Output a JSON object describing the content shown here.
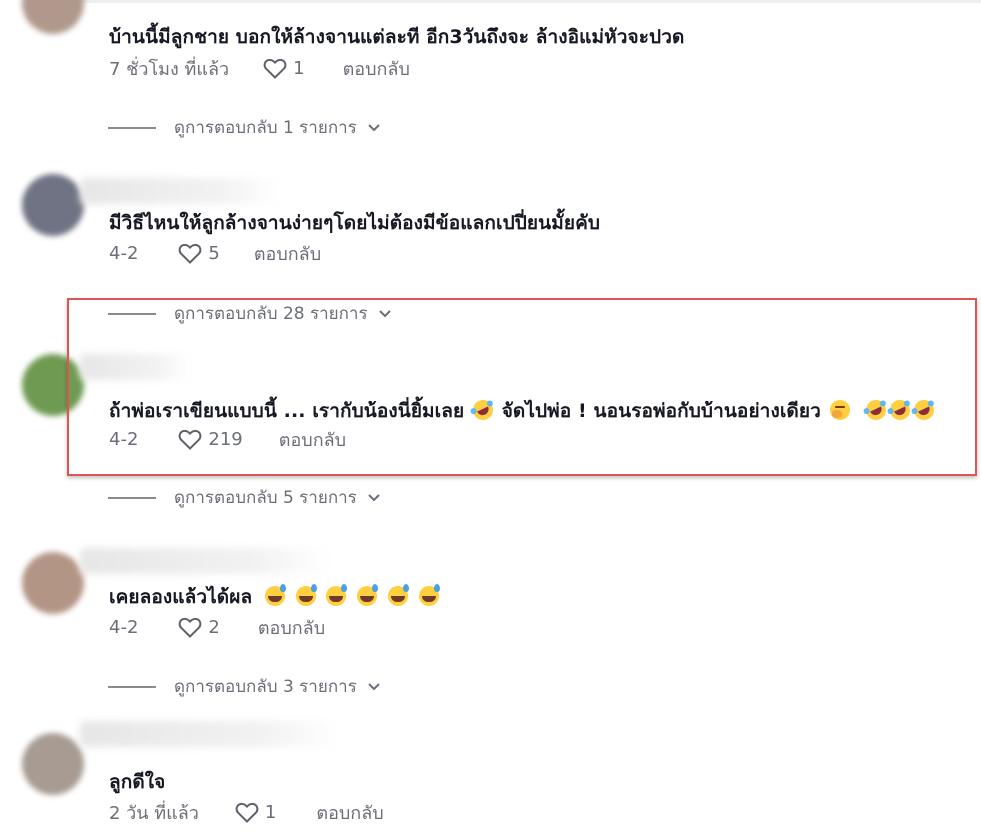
{
  "comments": [
    {
      "text": "บ้านนี้มีลูกชาย บอกให้ล้างจานแต่ละที อีก3วันถึงจะ ล้างอิแม่หัวจะปวด",
      "time": "7 ชั่วโมง ที่แล้ว",
      "likes": "1",
      "reply_label": "ตอบกลับ",
      "view_replies": "ดูการตอบกลับ 1 รายการ",
      "avatar_color": "#b0998c"
    },
    {
      "text": "มีวิธีไหนให้ลูกล้างจานง่ายๆโดยไม่ต้องมีข้อแลกเปปี่ยนมั้ยคับ",
      "time": "4-2",
      "likes": "5",
      "reply_label": "ตอบกลับ",
      "view_replies": "ดูการตอบกลับ 28 รายการ",
      "avatar_color": "#6f7383"
    },
    {
      "text_part1": "ถ้าพ่อเราเขียนแบบนี้ ... เรากับน้องนี่ยิ้มเลย",
      "text_part2": "จัดไปพ่อ ! นอนรอพ่อกับบ้านอย่างเดียว",
      "time": "4-2",
      "likes": "219",
      "reply_label": "ตอบกลับ",
      "view_replies": "ดูการตอบกลับ 5 รายการ",
      "avatar_color": "#6f9a52",
      "highlighted": true
    },
    {
      "text": "เคยลองแล้วได้ผล",
      "time": "4-2",
      "likes": "2",
      "reply_label": "ตอบกลับ",
      "view_replies": "ดูการตอบกลับ 3 รายการ",
      "avatar_color": "#b39585"
    },
    {
      "text": "ลูกดีใจ",
      "time": "2 วัน ที่แล้ว",
      "likes": "1",
      "reply_label": "ตอบกลับ",
      "avatar_color": "#a79b92"
    }
  ],
  "colors": {
    "text": "#161823",
    "meta": "#6b6e77",
    "highlight_border": "#e05454"
  },
  "icons": {
    "like": "heart-outline-icon",
    "expand": "chevron-down-icon"
  }
}
